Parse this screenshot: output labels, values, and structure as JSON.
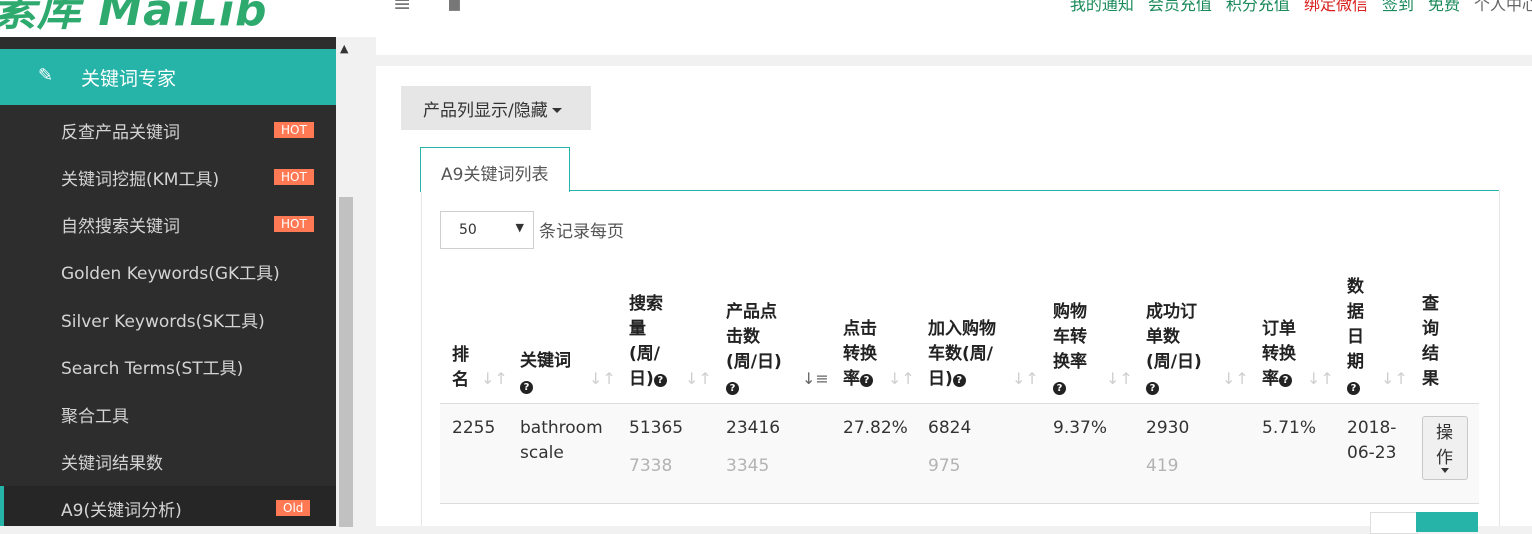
{
  "brand": {
    "logo": "素库 MaiLib"
  },
  "topnav": {
    "items": [
      {
        "label": "我的通知",
        "style": "normal"
      },
      {
        "label": "会员充值",
        "style": "normal"
      },
      {
        "label": "积分充值",
        "style": "normal"
      },
      {
        "label": "绑定微信",
        "style": "red"
      },
      {
        "label": "签到",
        "style": "normal"
      },
      {
        "label": "免费",
        "style": "normal"
      },
      {
        "label": "个人中心",
        "style": "gray"
      }
    ]
  },
  "sidebar": {
    "section": {
      "label": "关键词专家",
      "icon": "edit-icon"
    },
    "items": [
      {
        "label": "反查产品关键词",
        "badge": "HOT"
      },
      {
        "label": "关键词挖掘(KM工具)",
        "badge": "HOT"
      },
      {
        "label": "自然搜索关键词",
        "badge": "HOT"
      },
      {
        "label": "Golden Keywords(GK工具)",
        "badge": ""
      },
      {
        "label": "Silver Keywords(SK工具)",
        "badge": ""
      },
      {
        "label": "Search Terms(ST工具)",
        "badge": ""
      },
      {
        "label": "聚合工具",
        "badge": ""
      },
      {
        "label": "关键词结果数",
        "badge": ""
      },
      {
        "label": "A9(关键词分析)",
        "badge": "Old",
        "active": true
      }
    ]
  },
  "toolbar": {
    "column_toggle": "产品列显示/隐藏"
  },
  "tab": {
    "label": "A9关键词列表"
  },
  "page_length": {
    "value": "50",
    "label": "条记录每页"
  },
  "table": {
    "headers": {
      "rank": "排名",
      "keyword": "关键词",
      "search_volume": "搜索量(周/日)",
      "product_clicks": "产品点击数(周/日)",
      "click_conversion": "点击转换率",
      "add_to_cart": "加入购物车数(周/日)",
      "cart_conversion": "购物车转换率",
      "orders": "成功订单数(周/日)",
      "order_conversion": "订单转换率",
      "data_date": "数据日期",
      "query_result": "查询结果"
    },
    "rows": [
      {
        "rank": "2255",
        "keyword_line1": "bathroom",
        "keyword_line2": "scale",
        "search_volume_week": "51365",
        "search_volume_day": "7338",
        "clicks_week": "23416",
        "clicks_day": "3345",
        "click_conversion": "27.82%",
        "cart_week": "6824",
        "cart_day": "975",
        "cart_conversion": "9.37%",
        "orders_week": "2930",
        "orders_day": "419",
        "order_conversion": "5.71%",
        "date_line1": "2018-",
        "date_line2": "06-23",
        "action_line1": "操",
        "action_line2": "作"
      }
    ]
  },
  "colors": {
    "accent": "#26b3a8",
    "badge": "#ff7a54",
    "sidebar_bg": "#2d2d2d",
    "brand_green": "#2eaa6f"
  }
}
